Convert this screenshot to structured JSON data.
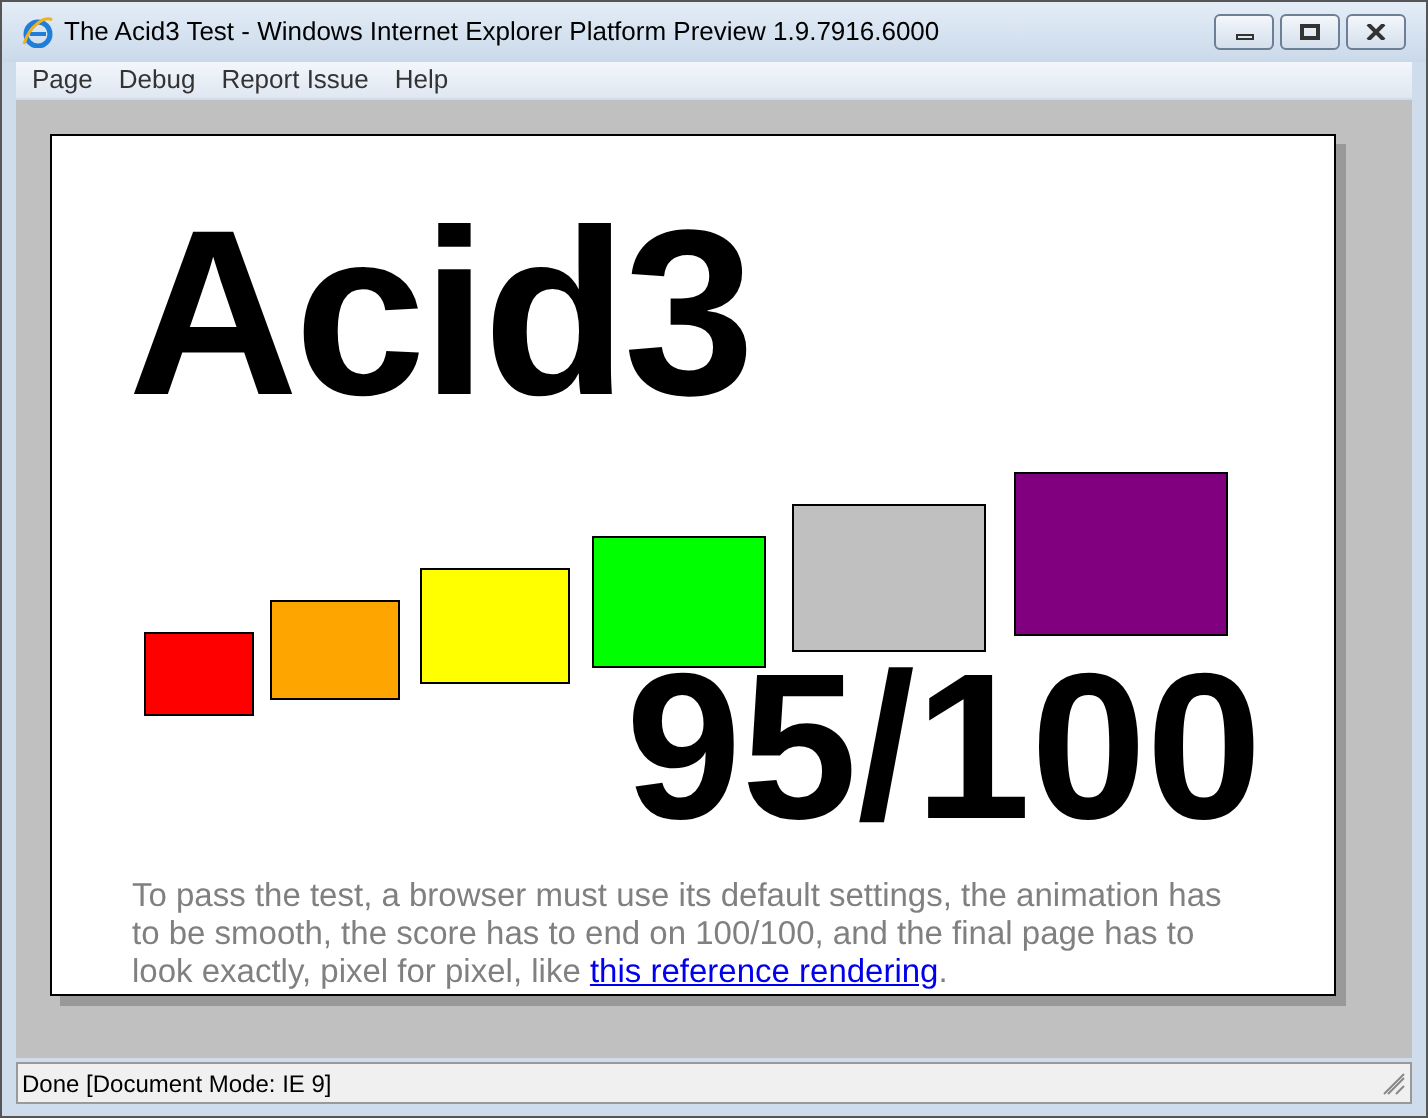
{
  "window": {
    "title": "The Acid3 Test - Windows Internet Explorer Platform Preview 1.9.7916.6000"
  },
  "menu": [
    "Page",
    "Debug",
    "Report Issue",
    "Help"
  ],
  "page": {
    "heading": "Acid3",
    "boxes": [
      {
        "color": "#ff0000"
      },
      {
        "color": "#ffa500"
      },
      {
        "color": "#ffff00"
      },
      {
        "color": "#00ff00"
      },
      {
        "color": "#c0c0c0"
      },
      {
        "color": "#800080"
      }
    ],
    "score": "95/100",
    "text": "To pass the test, a browser must use its default settings, the animation has to be smooth, the score has to end on 100/100, and the final page has to look exactly, pixel for pixel, like ",
    "link": "this reference rendering",
    "text_end": "."
  },
  "status_bar": "Done [Document Mode: IE 9]"
}
